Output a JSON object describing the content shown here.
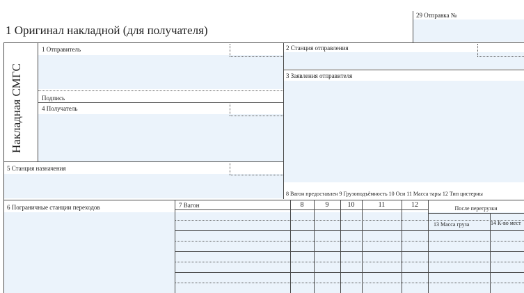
{
  "form": {
    "title": "1 Оригинал накладной (для получателя)",
    "side_label": "Накладная СМГС",
    "f29_label": "29 Отправка №"
  },
  "fields": {
    "f1_sender": "1 Отправитель",
    "f1_signature": "Подпись",
    "f2_departure_station": "2 Станция отправления",
    "f3_sender_statements": "3 Заявления отправителя",
    "f4_consignee": "4 Получатель",
    "f5_destination_station": "5 Станция назначения",
    "f6_border_stations": "6 Пограничные станции переходов",
    "f7_wagon": "7 Вагон"
  },
  "wagon_columns": {
    "header_line": "8 Вагон предоставлен  9 Грузоподъёмность  10 Оси  11 Масса тары  12 Тип цистерны",
    "numbers": [
      "8",
      "9",
      "10",
      "11",
      "12"
    ],
    "after_reloading": "После перегрузки",
    "f13_cargo_mass": "13 Масса груза",
    "f14_places": "14 К-во мест"
  }
}
